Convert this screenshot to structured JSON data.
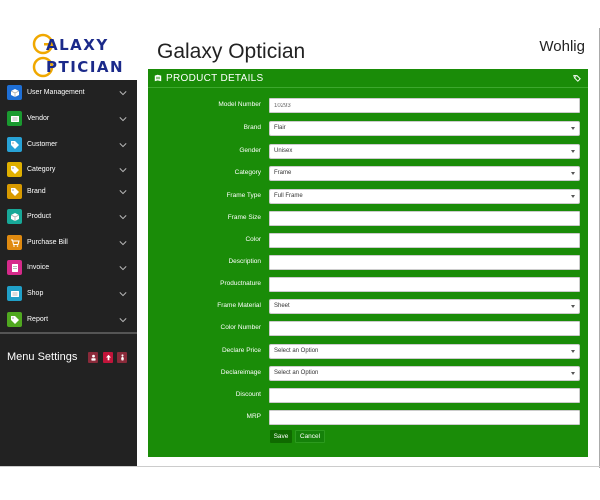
{
  "logo": {
    "line1": "ALAXY",
    "line2": "PTICIAN"
  },
  "header": {
    "title": "Galaxy Optician",
    "user": "Wohlig"
  },
  "colors": {
    "panel": "#1a8c08",
    "sidebar": "#222222",
    "accent_blue": "#1b2a8a"
  },
  "sidebar": {
    "items": [
      {
        "label": "User Management",
        "icon": "cube-icon",
        "color": "#1e6fd6"
      },
      {
        "label": "Vendor",
        "icon": "list-icon",
        "color": "#1a9a30"
      },
      {
        "label": "Customer",
        "icon": "tag-icon",
        "color": "#28a2d6"
      },
      {
        "label": "Category",
        "icon": "tag-icon",
        "color": "#e0b000"
      },
      {
        "label": "Brand",
        "icon": "tag-icon",
        "color": "#d89a00"
      },
      {
        "label": "Product",
        "icon": "cube-icon",
        "color": "#18a898"
      },
      {
        "label": "Purchase Bill",
        "icon": "cart-icon",
        "color": "#e08a10"
      },
      {
        "label": "Invoice",
        "icon": "document-icon",
        "color": "#d62a8a"
      },
      {
        "label": "Shop",
        "icon": "list-icon",
        "color": "#20a0c8"
      },
      {
        "label": "Report",
        "icon": "tag-icon",
        "color": "#50a820"
      }
    ],
    "menu_settings": "Menu Settings"
  },
  "panel": {
    "title": "PRODUCT DETAILS",
    "fields": [
      {
        "label": "Model Number",
        "type": "input",
        "value": "10293"
      },
      {
        "label": "Brand",
        "type": "select",
        "value": "Flair"
      },
      {
        "label": "Gender",
        "type": "select",
        "value": "Unisex"
      },
      {
        "label": "Category",
        "type": "select",
        "value": "Frame"
      },
      {
        "label": "Frame Type",
        "type": "select",
        "value": "Full Frame"
      },
      {
        "label": "Frame Size",
        "type": "input",
        "value": ""
      },
      {
        "label": "Color",
        "type": "input",
        "value": ""
      },
      {
        "label": "Description",
        "type": "input",
        "value": ""
      },
      {
        "label": "Productnature",
        "type": "input",
        "value": ""
      },
      {
        "label": "Frame Material",
        "type": "select",
        "value": "Sheet"
      },
      {
        "label": "Color Number",
        "type": "input",
        "value": ""
      },
      {
        "label": "Declare Price",
        "type": "select",
        "value": "Select an Option"
      },
      {
        "label": "Declareimage",
        "type": "select",
        "value": "Select an Option"
      },
      {
        "label": "Discount",
        "type": "input",
        "value": ""
      },
      {
        "label": "MRP",
        "type": "input",
        "value": ""
      }
    ],
    "save": "Save",
    "cancel": "Cancel"
  }
}
